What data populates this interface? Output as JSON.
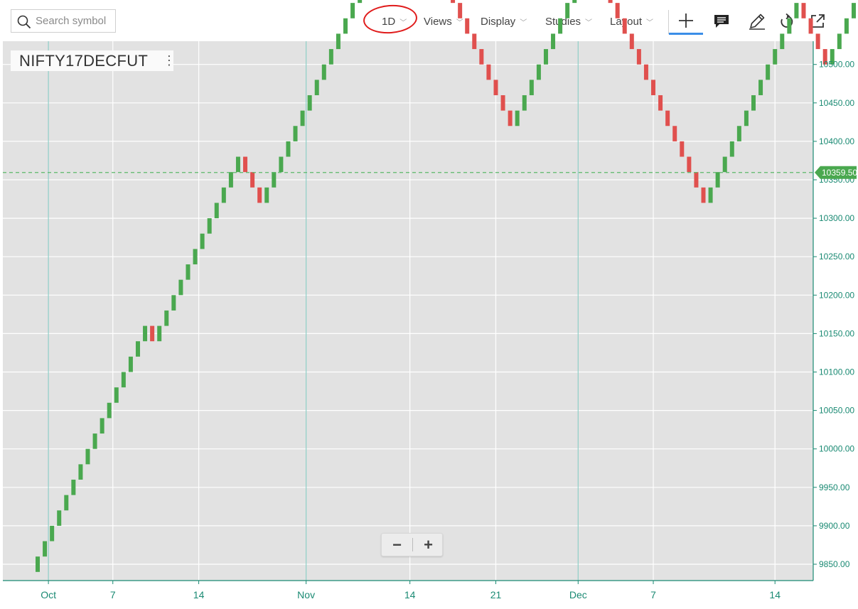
{
  "toolbar": {
    "search_placeholder": "Search symbol",
    "interval": "1D",
    "views": "Views",
    "display": "Display",
    "studies": "Studies",
    "layout": "Layout",
    "tools": [
      "crosshair-icon",
      "comment-icon",
      "draw-pencil-icon",
      "reset-icon",
      "popout-icon"
    ]
  },
  "symbol": "NIFTY17DECFUT",
  "zoom": {
    "minus": "−",
    "plus": "+"
  },
  "colors": {
    "up": "#4aa84f",
    "down": "#e0504e",
    "axis": "#1a8a73",
    "last_price_line": "#5bb86a",
    "background": "#e2e2e2",
    "annotation": "#e01b1b"
  },
  "chart_data": {
    "type": "renko",
    "symbol": "NIFTY17DECFUT",
    "interval": "1D",
    "box_size": 20,
    "ylim": [
      9830,
      10530
    ],
    "y_ticks": [
      9850,
      9900,
      9950,
      10000,
      10050,
      10100,
      10150,
      10200,
      10250,
      10300,
      10350,
      10400,
      10450,
      10500
    ],
    "x_ticks": [
      {
        "label": "Oct",
        "brick": 1.5,
        "month": true
      },
      {
        "label": "7",
        "brick": 10.5,
        "month": false
      },
      {
        "label": "14",
        "brick": 22.5,
        "month": false
      },
      {
        "label": "Nov",
        "brick": 37.5,
        "month": true
      },
      {
        "label": "14",
        "brick": 52,
        "month": false
      },
      {
        "label": "21",
        "brick": 64,
        "month": false
      },
      {
        "label": "Dec",
        "brick": 75.5,
        "month": true
      },
      {
        "label": "7",
        "brick": 86,
        "month": false
      },
      {
        "label": "14",
        "brick": 103,
        "month": false
      }
    ],
    "start_price": 9840,
    "bricks": [
      "up",
      "up",
      "up",
      "up",
      "up",
      "up",
      "up",
      "up",
      "up",
      "up",
      "up",
      "up",
      "up",
      "up",
      "up",
      "up",
      "down",
      "up",
      "up",
      "up",
      "up",
      "up",
      "up",
      "up",
      "up",
      "up",
      "up",
      "up",
      "up",
      "down",
      "down",
      "down",
      "up",
      "up",
      "up",
      "up",
      "up",
      "up",
      "up",
      "up",
      "up",
      "up",
      "up",
      "up",
      "up",
      "up",
      "up",
      "up",
      "up",
      "up",
      "up",
      "up",
      "down",
      "down",
      "down",
      "down",
      "down",
      "down",
      "down",
      "down",
      "down",
      "down",
      "down",
      "down",
      "down",
      "down",
      "down",
      "up",
      "up",
      "up",
      "up",
      "up",
      "up",
      "up",
      "up",
      "up",
      "up",
      "up",
      "down",
      "down",
      "down",
      "down",
      "down",
      "down",
      "down",
      "down",
      "down",
      "down",
      "down",
      "down",
      "down",
      "down",
      "down",
      "down",
      "up",
      "up",
      "up",
      "up",
      "up",
      "up",
      "up",
      "up",
      "up",
      "up",
      "up",
      "up",
      "up",
      "down",
      "down",
      "down",
      "down",
      "up",
      "up",
      "up",
      "up",
      "up",
      "up"
    ],
    "last_price": "10359.50",
    "last_price_value": 10359.5
  }
}
